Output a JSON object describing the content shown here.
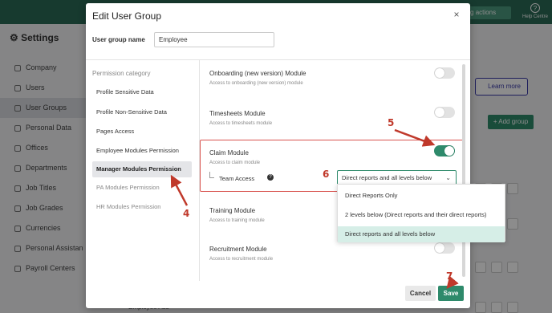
{
  "app": {
    "pending_label": "nding actions",
    "help_label": "Help Centre",
    "settings_title": "Settings",
    "sidebar": [
      {
        "label": "Company"
      },
      {
        "label": "Users"
      },
      {
        "label": "User Groups"
      },
      {
        "label": "Personal Data"
      },
      {
        "label": "Offices"
      },
      {
        "label": "Departments"
      },
      {
        "label": "Job Titles"
      },
      {
        "label": "Job Grades"
      },
      {
        "label": "Currencies"
      },
      {
        "label": "Personal Assistan"
      },
      {
        "label": "Payroll Centers"
      }
    ],
    "learn_more": "Learn more",
    "add_group": "+ Add group",
    "bottom_row": "Employee Ass"
  },
  "modal": {
    "title": "Edit User Group",
    "close": "×",
    "name_label": "User group name",
    "name_value": "Employee",
    "category_heading": "Permission category",
    "categories": [
      {
        "label": "Profile Sensitive Data"
      },
      {
        "label": "Profile Non-Sensitive Data"
      },
      {
        "label": "Pages Access"
      },
      {
        "label": "Employee Modules Permission"
      },
      {
        "label": "Manager Modules Permission"
      },
      {
        "label": "PA Modules Permission"
      },
      {
        "label": "HR Modules Permission"
      }
    ],
    "modules": [
      {
        "name": "Onboarding (new version) Module",
        "sub": "Access to onboarding (new version) module",
        "enabled": false
      },
      {
        "name": "Timesheets Module",
        "sub": "Access to timesheets module",
        "enabled": false
      },
      {
        "name": "Claim Module",
        "sub": "Access to claim module",
        "enabled": true
      },
      {
        "name": "Training Module",
        "sub": "Access to training module",
        "enabled": false
      },
      {
        "name": "Recruitment Module",
        "sub": "Access to recruitment module",
        "enabled": false
      }
    ],
    "team_access_label": "Team Access",
    "team_access_value": "Direct reports and all levels below",
    "cancel": "Cancel",
    "save": "Save"
  },
  "dropdown": {
    "options": [
      "Direct Reports Only",
      "2 levels below (Direct reports and their direct reports)",
      "Direct reports and all levels below"
    ],
    "selected_index": 2
  },
  "annotations": [
    "4",
    "5",
    "6",
    "7"
  ],
  "colors": {
    "accent": "#2e8a6b",
    "highlight": "#d9534f"
  }
}
